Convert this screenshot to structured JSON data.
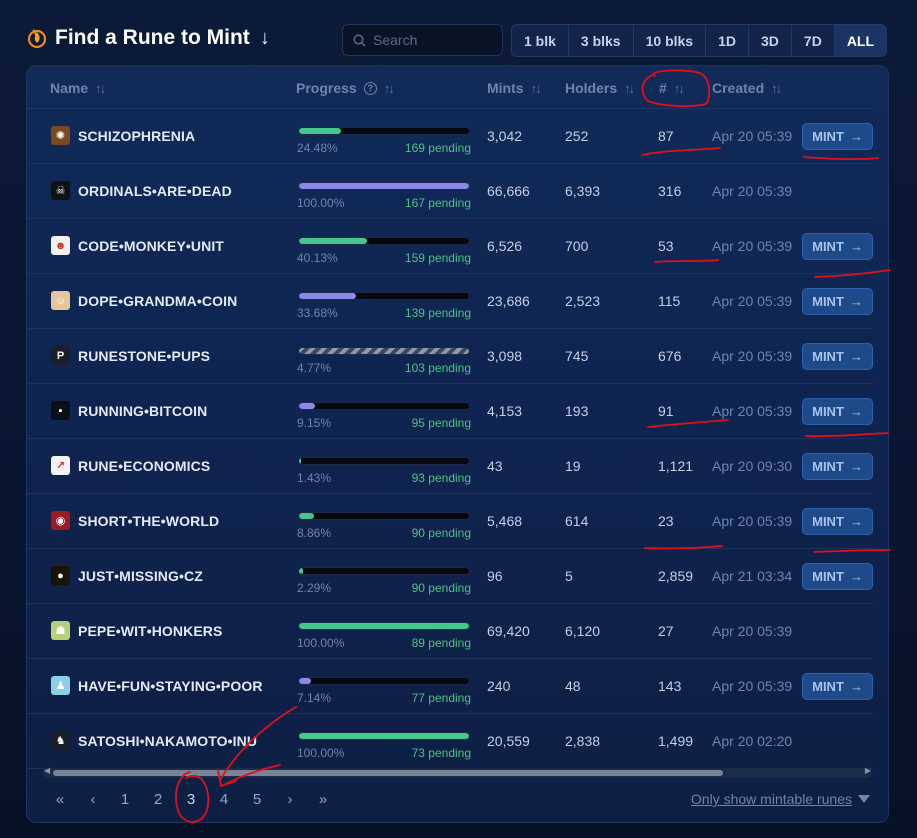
{
  "header": {
    "title": "Find a Rune to Mint",
    "title_arrow": "↓",
    "search_placeholder": "Search",
    "timeframes": [
      {
        "label": "1 blk",
        "active": false
      },
      {
        "label": "3 blks",
        "active": false
      },
      {
        "label": "10 blks",
        "active": false
      },
      {
        "label": "1D",
        "active": false
      },
      {
        "label": "3D",
        "active": false
      },
      {
        "label": "7D",
        "active": false
      },
      {
        "label": "ALL",
        "active": true
      }
    ]
  },
  "table": {
    "columns": {
      "name": "Name",
      "progress": "Progress",
      "mints": "Mints",
      "holders": "Holders",
      "number": "#",
      "created": "Created"
    },
    "sort_glyph": "↑↓",
    "help_glyph": "?",
    "mint_label": "MINT",
    "mint_arrow": "→",
    "rows": [
      {
        "name": "SCHIZOPHRENIA",
        "progress_pct": "24.48%",
        "progress": 0.2448,
        "bar": "green",
        "pending": "169 pending",
        "mints": "3,042",
        "holders": "252",
        "number": "87",
        "created": "Apr 20 05:39",
        "mintable": true,
        "icon_color": "#7a4a1e",
        "icon_glyph": "✺"
      },
      {
        "name": "ORDINALS•ARE•DEAD",
        "progress_pct": "100.00%",
        "progress": 1.0,
        "bar": "purple",
        "pending": "167 pending",
        "mints": "66,666",
        "holders": "6,393",
        "number": "316",
        "created": "Apr 20 05:39",
        "mintable": false,
        "icon_color": "#111111",
        "icon_glyph": "☠"
      },
      {
        "name": "CODE•MONKEY•UNIT",
        "progress_pct": "40.13%",
        "progress": 0.4013,
        "bar": "green",
        "pending": "159 pending",
        "mints": "6,526",
        "holders": "700",
        "number": "53",
        "created": "Apr 20 05:39",
        "mintable": true,
        "icon_color": "#f2f2f2",
        "icon_glyph": "☻"
      },
      {
        "name": "DOPE•GRANDMA•COIN",
        "progress_pct": "33.68%",
        "progress": 0.3368,
        "bar": "purple",
        "pending": "139 pending",
        "mints": "23,686",
        "holders": "2,523",
        "number": "115",
        "created": "Apr 20 05:39",
        "mintable": true,
        "icon_color": "#e5c59a",
        "icon_glyph": "☺"
      },
      {
        "name": "RUNESTONE•PUPS",
        "progress_pct": "4.77%",
        "progress": 1.0,
        "bar": "striped",
        "pending": "103 pending",
        "mints": "3,098",
        "holders": "745",
        "number": "676",
        "created": "Apr 20 05:39",
        "mintable": true,
        "icon_color": "#1b1f2a",
        "icon_glyph": "P"
      },
      {
        "name": "RUNNING•BITCOIN",
        "progress_pct": "9.15%",
        "progress": 0.0915,
        "bar": "purple",
        "pending": "95 pending",
        "mints": "4,153",
        "holders": "193",
        "number": "91",
        "created": "Apr 20 05:39",
        "mintable": true,
        "icon_color": "#0c0f16",
        "icon_glyph": "▪"
      },
      {
        "name": "RUNE•ECONOMICS",
        "progress_pct": "1.43%",
        "progress": 0.0143,
        "bar": "green",
        "pending": "93 pending",
        "mints": "43",
        "holders": "19",
        "number": "1,121",
        "created": "Apr 20 09:30",
        "mintable": true,
        "icon_color": "#f4f4f4",
        "icon_glyph": "↗"
      },
      {
        "name": "SHORT•THE•WORLD",
        "progress_pct": "8.86%",
        "progress": 0.0886,
        "bar": "green",
        "pending": "90 pending",
        "mints": "5,468",
        "holders": "614",
        "number": "23",
        "created": "Apr 20 05:39",
        "mintable": true,
        "icon_color": "#9b1b25",
        "icon_glyph": "◉"
      },
      {
        "name": "JUST•MISSING•CZ",
        "progress_pct": "2.29%",
        "progress": 0.0229,
        "bar": "green",
        "pending": "90 pending",
        "mints": "96",
        "holders": "5",
        "number": "2,859",
        "created": "Apr 21 03:34",
        "mintable": true,
        "icon_color": "#1a1406",
        "icon_glyph": "●"
      },
      {
        "name": "PEPE•WIT•HONKERS",
        "progress_pct": "100.00%",
        "progress": 1.0,
        "bar": "green",
        "pending": "89 pending",
        "mints": "69,420",
        "holders": "6,120",
        "number": "27",
        "created": "Apr 20 05:39",
        "mintable": false,
        "icon_color": "#b7d07a",
        "icon_glyph": "☗"
      },
      {
        "name": "HAVE•FUN•STAYING•POOR",
        "progress_pct": "7.14%",
        "progress": 0.0714,
        "bar": "purple",
        "pending": "77 pending",
        "mints": "240",
        "holders": "48",
        "number": "143",
        "created": "Apr 20 05:39",
        "mintable": true,
        "icon_color": "#8ad0e8",
        "icon_glyph": "♟"
      },
      {
        "name": "SATOSHI•NAKAMOTO•INU",
        "progress_pct": "100.00%",
        "progress": 1.0,
        "bar": "green",
        "pending": "73 pending",
        "mints": "20,559",
        "holders": "2,838",
        "number": "1,499",
        "created": "Apr 20 02:20",
        "mintable": false,
        "icon_color": "#1b1f2a",
        "icon_glyph": "♞"
      }
    ]
  },
  "pagination": {
    "first": "«",
    "prev": "‹",
    "pages": [
      "1",
      "2",
      "3",
      "4",
      "5"
    ],
    "active_page": "3",
    "next": "›",
    "last": "»"
  },
  "filter": {
    "label": "Only show mintable runes"
  },
  "colors": {
    "accent": "#1f4a8a",
    "green": "#45c78d",
    "purple": "#8d87e8",
    "annotation": "#e0101a"
  }
}
